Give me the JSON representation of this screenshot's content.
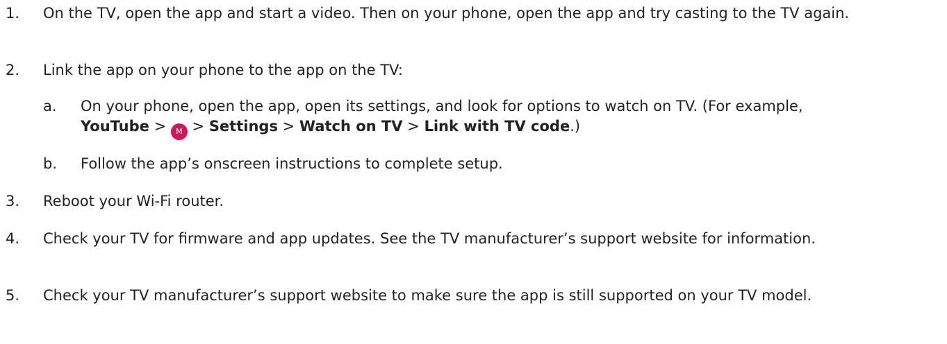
{
  "steps": [
    {
      "number": "1.",
      "text": "On the TV, open the app and start a video. Then on your phone, open the app and try casting to the TV again."
    },
    {
      "number": "2.",
      "text": "Link the app on your phone to the app on the TV:"
    },
    {
      "number": "3.",
      "text": "Reboot your Wi-Fi router."
    },
    {
      "number": "4.",
      "text": "Check your TV for firmware and app updates. See the TV manufacturer’s support website for information."
    },
    {
      "number": "5.",
      "text": "Check your TV manufacturer’s support website to make sure the app is still supported on your TV model."
    }
  ],
  "substeps": [
    {
      "letter": "a.",
      "text_before": "On your phone, open the app, open its settings, and look for options to watch on TV. (For example,",
      "path": {
        "youtube": "YouTube",
        "sep1": " > ",
        "avatar_letter": "M",
        "sep2": " > ",
        "settings": "Settings",
        "sep3": " > ",
        "watch_on_tv": "Watch on TV",
        "sep4": " > ",
        "link_code": "Link with TV code",
        "end": ".)"
      }
    },
    {
      "letter": "b.",
      "text": "Follow the app’s onscreen instructions to complete setup."
    }
  ],
  "colors": {
    "text": "#222222",
    "avatar_bg": "#d4145a"
  }
}
